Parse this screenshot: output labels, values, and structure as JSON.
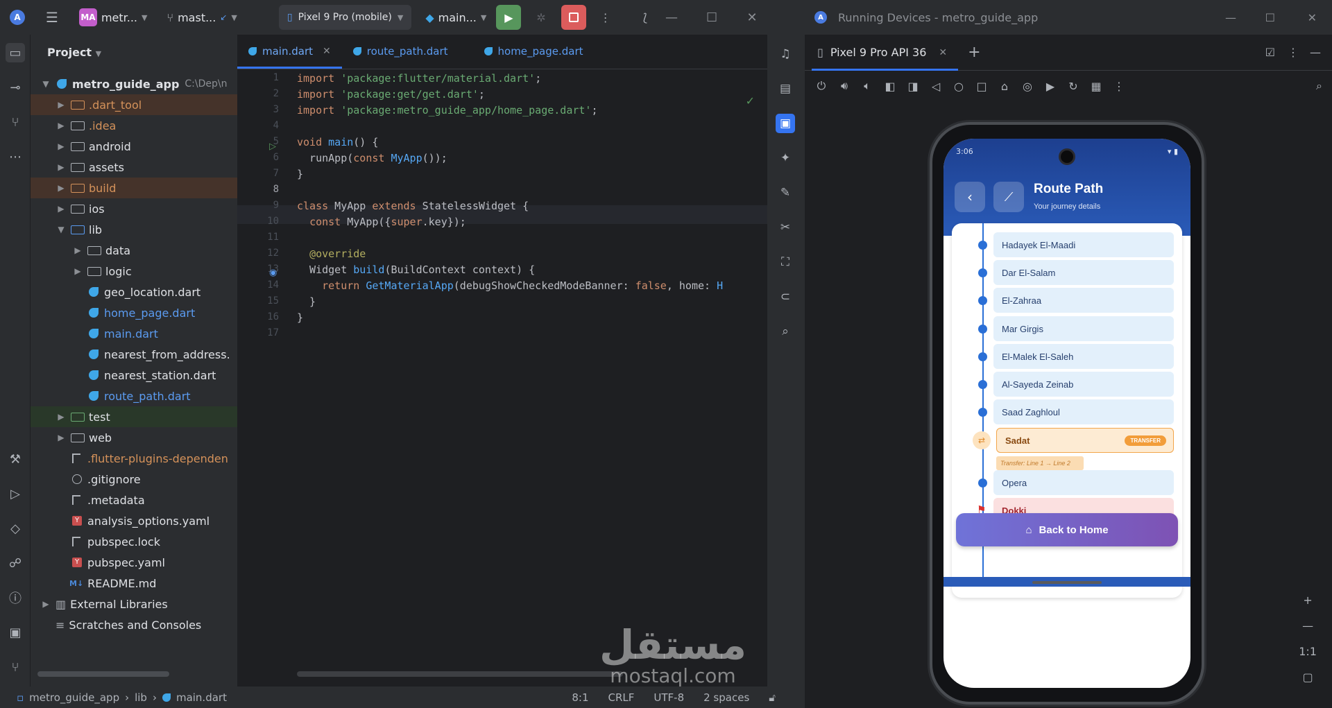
{
  "titlebar": {
    "project_badge": "MA",
    "project_name": "metr...",
    "branch": "mast...",
    "device": "Pixel 9 Pro (mobile)",
    "run_config": "main...",
    "minimize": "—",
    "maximize": "☐",
    "close": "✕"
  },
  "project_panel": {
    "title": "Project",
    "root_name": "metro_guide_app",
    "root_path": "C:\\Dep\\n",
    "items": [
      {
        "label": ".dart_tool"
      },
      {
        "label": ".idea"
      },
      {
        "label": "android"
      },
      {
        "label": "assets"
      },
      {
        "label": "build"
      },
      {
        "label": "ios"
      },
      {
        "label": "lib"
      },
      {
        "label": "data"
      },
      {
        "label": "logic"
      },
      {
        "label": "geo_location.dart"
      },
      {
        "label": "home_page.dart"
      },
      {
        "label": "main.dart"
      },
      {
        "label": "nearest_from_address."
      },
      {
        "label": "nearest_station.dart"
      },
      {
        "label": "route_path.dart"
      },
      {
        "label": "test"
      },
      {
        "label": "web"
      },
      {
        "label": ".flutter-plugins-dependen"
      },
      {
        "label": ".gitignore"
      },
      {
        "label": ".metadata"
      },
      {
        "label": "analysis_options.yaml"
      },
      {
        "label": "pubspec.lock"
      },
      {
        "label": "pubspec.yaml"
      },
      {
        "label": "README.md"
      },
      {
        "label": "External Libraries"
      },
      {
        "label": "Scratches and Consoles"
      }
    ]
  },
  "editor": {
    "tabs": [
      {
        "label": "main.dart"
      },
      {
        "label": "route_path.dart"
      },
      {
        "label": "home_page.dart"
      }
    ],
    "line_numbers": [
      "1",
      "2",
      "3",
      "4",
      "5",
      "6",
      "7",
      "8",
      "9",
      "10",
      "11",
      "12",
      "13",
      "14",
      "15",
      "16",
      "17"
    ]
  },
  "statusbar": {
    "crumb_project": "metro_guide_app",
    "crumb_dir": "lib",
    "crumb_file": "main.dart",
    "position": "8:1",
    "line_endings": "CRLF",
    "encoding": "UTF-8",
    "indent": "2 spaces"
  },
  "running_devices": {
    "title": "Running Devices - metro_guide_app",
    "tab": "Pixel 9 Pro API 36",
    "zoom_label": "1:1"
  },
  "app": {
    "status_time": "3:06",
    "title": "Route Path",
    "subtitle": "Your journey details",
    "stations": [
      "Hadayek El-Maadi",
      "Dar El-Salam",
      "El-Zahraa",
      "Mar Girgis",
      "El-Malek El-Saleh",
      "Al-Sayeda Zeinab",
      "Saad Zaghloul"
    ],
    "transfer_station": "Sadat",
    "transfer_badge": "TRANSFER",
    "transfer_note": "Transfer: Line 1 → Line 2",
    "after_transfer": [
      "Opera"
    ],
    "destination": "Dokki",
    "home_button": "Back to Home"
  },
  "watermark": {
    "arabic": "مستقل",
    "latin": "mostaql.com"
  },
  "colors": {
    "ide_bg": "#1e1f22",
    "panel_bg": "#2b2d30",
    "accent": "#3574f0",
    "run_green": "#57965c",
    "stop_red": "#db5c5c",
    "appbar_blue": "#2a5bb8",
    "station_bg": "#e3f0fb",
    "transfer_orange": "#f29d3a",
    "destination_red": "#d9302f"
  }
}
